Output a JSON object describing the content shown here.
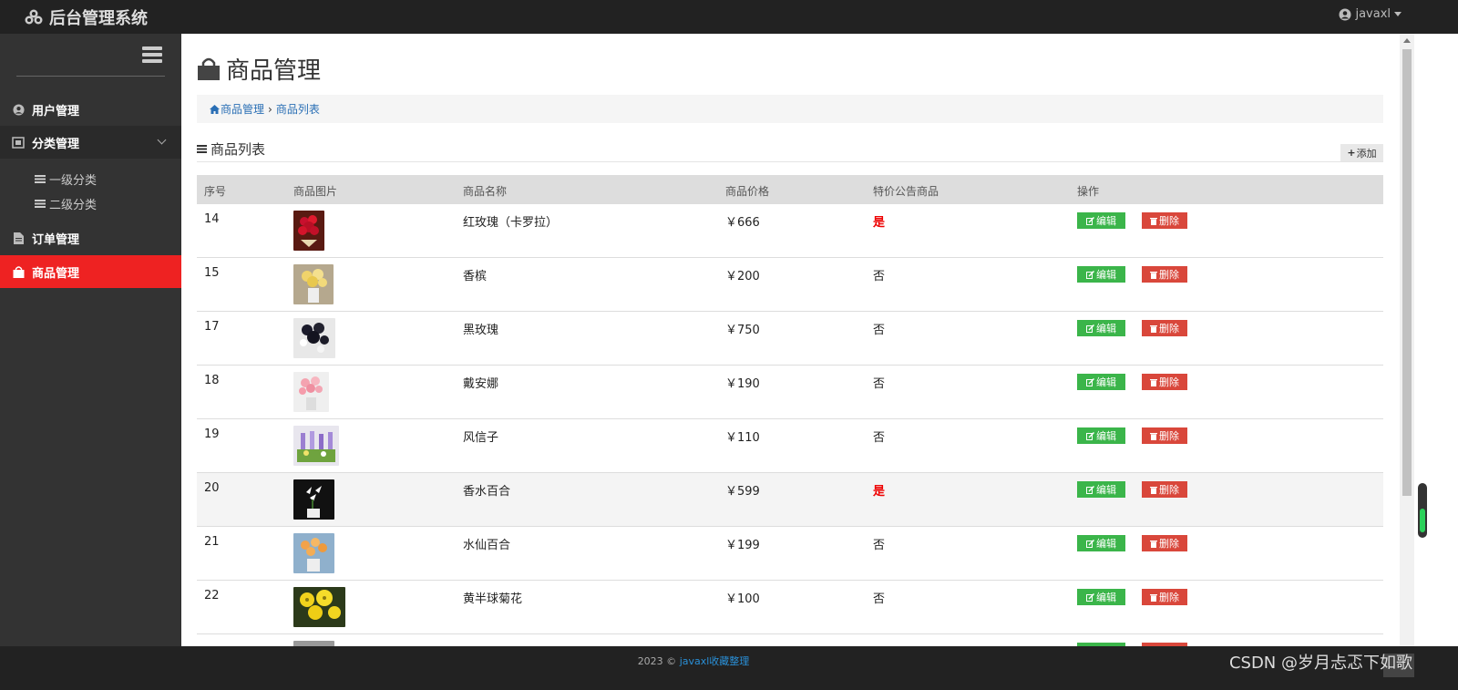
{
  "header": {
    "title": "后台管理系统",
    "user": "javaxl"
  },
  "sidebar": {
    "items": [
      {
        "label": "用户管理",
        "icon": "user-circle-icon"
      },
      {
        "label": "分类管理",
        "icon": "category-icon"
      },
      {
        "label": "订单管理",
        "icon": "file-icon"
      },
      {
        "label": "商品管理",
        "icon": "shopping-bag-icon"
      }
    ],
    "sub_items": [
      "一级分类",
      "二级分类"
    ]
  },
  "page": {
    "title": "商品管理",
    "breadcrumb": [
      "商品管理",
      "商品列表"
    ],
    "section_title": "商品列表",
    "add_label": "添加"
  },
  "table": {
    "headers": [
      "序号",
      "商品图片",
      "商品名称",
      "商品价格",
      "特价公告商品",
      "操作"
    ],
    "edit_label": "编辑",
    "delete_label": "删除",
    "rows": [
      {
        "id": "14",
        "name": "红玫瑰（卡罗拉）",
        "price": "￥666",
        "special": "是"
      },
      {
        "id": "15",
        "name": "香槟",
        "price": "￥200",
        "special": "否"
      },
      {
        "id": "17",
        "name": "黑玫瑰",
        "price": "￥750",
        "special": "否"
      },
      {
        "id": "18",
        "name": "戴安娜",
        "price": "￥190",
        "special": "否"
      },
      {
        "id": "19",
        "name": "风信子",
        "price": "￥110",
        "special": "否"
      },
      {
        "id": "20",
        "name": "香水百合",
        "price": "￥599",
        "special": "是"
      },
      {
        "id": "21",
        "name": "水仙百合",
        "price": "￥199",
        "special": "否"
      },
      {
        "id": "22",
        "name": "黄半球菊花",
        "price": "￥100",
        "special": "否"
      }
    ]
  },
  "footer": {
    "prefix": "2023 ©",
    "link": "javaxl收藏整理",
    "watermark": "CSDN @岁月忐忑下如歌"
  },
  "colors": {
    "active": "#ee2222",
    "edit": "#3bb54a",
    "delete": "#d9473b",
    "special_yes": "#ee0000"
  }
}
